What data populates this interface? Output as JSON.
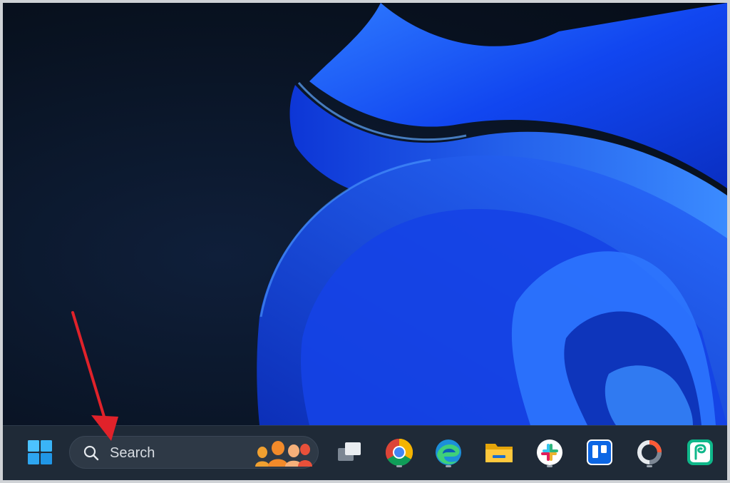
{
  "taskbar": {
    "search": {
      "label": "Search"
    },
    "apps": [
      {
        "name": "task-view",
        "running": false
      },
      {
        "name": "chrome",
        "running": true
      },
      {
        "name": "edge",
        "running": true
      },
      {
        "name": "file-explorer",
        "running": false
      },
      {
        "name": "slack",
        "running": true
      },
      {
        "name": "trello",
        "running": false
      },
      {
        "name": "app-circle",
        "running": true
      },
      {
        "name": "pushbullet",
        "running": false
      }
    ]
  },
  "colors": {
    "accent_arrow": "#e0222a",
    "taskbar_bg": "#1f2a37",
    "wallpaper_blue": "#1a4cff"
  },
  "icons": [
    "windows-start-icon",
    "search-icon",
    "search-highlight-people-icon",
    "task-view-icon",
    "chrome-icon",
    "edge-icon",
    "file-explorer-icon",
    "slack-icon",
    "trello-icon",
    "circle-app-icon",
    "pushbullet-icon"
  ]
}
